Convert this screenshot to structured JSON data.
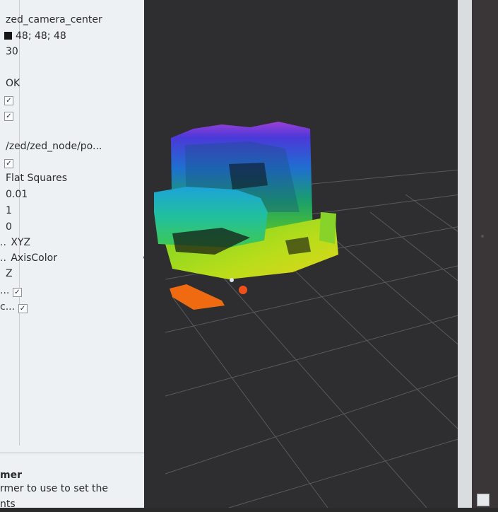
{
  "properties": [
    {
      "prefix": "",
      "value": "zed_camera_center",
      "type": "text"
    },
    {
      "prefix": "",
      "value": "48; 48; 48",
      "type": "color",
      "swatch": "#161616"
    },
    {
      "prefix": "",
      "value": "30",
      "type": "text"
    },
    {
      "prefix": "",
      "value": "",
      "type": "blank"
    },
    {
      "prefix": "",
      "value": "OK",
      "type": "text"
    },
    {
      "prefix": "",
      "value": "✓",
      "type": "check"
    },
    {
      "prefix": "",
      "value": "✓",
      "type": "check"
    },
    {
      "prefix": "",
      "value": "",
      "type": "blank"
    },
    {
      "prefix": "",
      "value": "/zed/zed_node/po...",
      "type": "text"
    },
    {
      "prefix": "",
      "value": "✓",
      "type": "check"
    },
    {
      "prefix": "",
      "value": "Flat Squares",
      "type": "text"
    },
    {
      "prefix": "",
      "value": "0.01",
      "type": "text"
    },
    {
      "prefix": "",
      "value": "1",
      "type": "text"
    },
    {
      "prefix": "",
      "value": "0",
      "type": "text"
    },
    {
      "prefix": "..",
      "value": "XYZ",
      "type": "text"
    },
    {
      "prefix": "..",
      "value": "AxisColor",
      "type": "text"
    },
    {
      "prefix": "",
      "value": "Z",
      "type": "text"
    },
    {
      "prefix": "...",
      "value": "✓",
      "type": "check"
    },
    {
      "prefix": "c...",
      "value": "✓",
      "type": "check"
    }
  ],
  "description": {
    "title": "mer",
    "text": "rmer to use to set the",
    "text2": "nts"
  },
  "colors": {
    "panel_bg": "#eef1f3",
    "view_bg": "#2e2e30",
    "grid": "#5a5a5c"
  }
}
